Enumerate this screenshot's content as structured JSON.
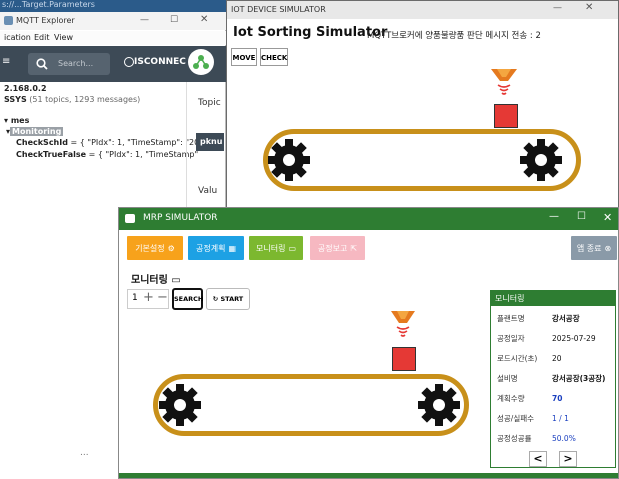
{
  "mqtt": {
    "title": "MQTT Explorer",
    "partial_url": "s://...Target.Parameters",
    "menu": [
      "ication",
      "Edit",
      "View"
    ],
    "search_placeholder": "Search...",
    "disconnect_label": "ISCONNEC",
    "host": "2.168.0.2",
    "broker_name": "SSYS",
    "broker_stats": "(51 topics, 1293 messages)",
    "tree_mes": "mes",
    "tree_monitoring": "Monitoring",
    "check_sched_key": "CheckSchId",
    "check_sched_val": "= { \"PIdx\": 1, \"TimeStamp\": \"20",
    "check_false_key": "CheckTrueFalse",
    "check_false_val": "= { \"PIdx\": 1, \"TimeStamp\"",
    "topic_label": "Topic",
    "topic_badge": "pknu",
    "value_label": "Valu",
    "footer_dots": "..."
  },
  "iot": {
    "window_title": "IOT DEVICE SIMULATOR",
    "heading": "Iot Sorting Simulator",
    "status_msg": "MQTT브로커에 양품불량품 판단 메시지 전송 : 2",
    "move_btn": "MOVE",
    "check_btn": "CHECK",
    "box_color": "#e53935",
    "belt_color": "#c8901a"
  },
  "mrp": {
    "window_title": "MRP SIMULATOR",
    "toolbar": [
      {
        "label": "기본설정",
        "color": "#f7a21b"
      },
      {
        "label": "공정계획",
        "color": "#1da1e4"
      },
      {
        "label": "모니터링",
        "color": "#7cb82f"
      },
      {
        "label": "공정보고",
        "color": "#f6b8c1"
      }
    ],
    "exit_label": "앱 종료",
    "section_title": "모니터링",
    "qty_value": "1",
    "search_btn": "SEARCH",
    "start_btn": "START",
    "panel_title": "모니터링",
    "rows": [
      {
        "key": "플랜트명",
        "value": "강서공장"
      },
      {
        "key": "공정일자",
        "value": "2025-07-29"
      },
      {
        "key": "로드시간(초)",
        "value": "20"
      },
      {
        "key": "설비명",
        "value": "강서공장(3공장)"
      },
      {
        "key": "계획수량",
        "value": "70"
      },
      {
        "key": "성공/실패수",
        "value": "1 / 1"
      },
      {
        "key": "공정성공률",
        "value": "50.0%"
      }
    ],
    "prev_btn": "<",
    "next_btn": ">"
  }
}
